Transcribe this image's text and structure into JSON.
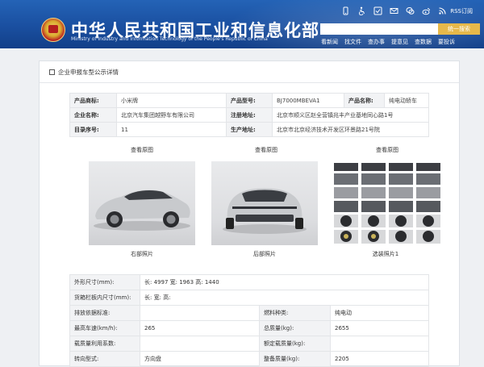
{
  "header": {
    "title": "中华人民共和国工业和信息化部",
    "subtitle": "Ministry of Industry and Information Technology of the People's Republic of China",
    "search_button": "统一搜索",
    "rss_label": "RSS订阅",
    "nav": [
      "看新闻",
      "找文件",
      "查办事",
      "提意见",
      "查数据",
      "要投诉"
    ]
  },
  "page": {
    "section_title": "企业申报车型公示详情"
  },
  "info": {
    "product_brand_label": "产品商标:",
    "product_brand": "小米牌",
    "product_model_label": "产品型号:",
    "product_model": "BJ7000MBEVA1",
    "product_name_label": "产品名称:",
    "product_name": "纯电动轿车",
    "company_label": "企业名称:",
    "company": "北京汽车集团越野车有限公司",
    "reg_address_label": "注册地址:",
    "reg_address": "北京市顺义区赵全营镇兆丰产业基地同心路1号",
    "catalog_no_label": "目录序号:",
    "catalog_no": "11",
    "prod_address_label": "生产地址:",
    "prod_address": "北京市北京经济技术开发区环景路21号院"
  },
  "photos": [
    {
      "link": "查看原图",
      "caption": "右部照片"
    },
    {
      "link": "查看原图",
      "caption": "后部照片"
    },
    {
      "link": "查看原图",
      "caption": "选装照片1"
    }
  ],
  "specs": {
    "dims_label": "外形尺寸(mm):",
    "dims": "长: 4997 宽: 1963 高: 1440",
    "cargo_label": "货箱栏板内尺寸(mm):",
    "cargo": "长:   宽:   高:",
    "emission_label": "排放依据标准:",
    "emission": "",
    "fuel_label": "燃料种类:",
    "fuel": "纯电动",
    "speed_label": "最高车速(km/h):",
    "speed": "265",
    "total_mass_label": "总质量(kg):",
    "total_mass": "2655",
    "load_coef_label": "载质量利用系数:",
    "load_coef": "",
    "rated_load_label": "额定载质量(kg):",
    "rated_load": "",
    "steering_label": "转向型式:",
    "steering": "方向盘",
    "curb_mass_label": "整备质量(kg):",
    "curb_mass": "2205"
  },
  "colors": {
    "header_blue": "#1a4fa0",
    "search_button": "#e6b84a",
    "car_body": "#c8cacd"
  },
  "icons": [
    "mobile-icon",
    "accessibility-icon",
    "care-mode-icon",
    "mail-icon",
    "wechat-icon",
    "weibo-icon",
    "rss-icon"
  ]
}
